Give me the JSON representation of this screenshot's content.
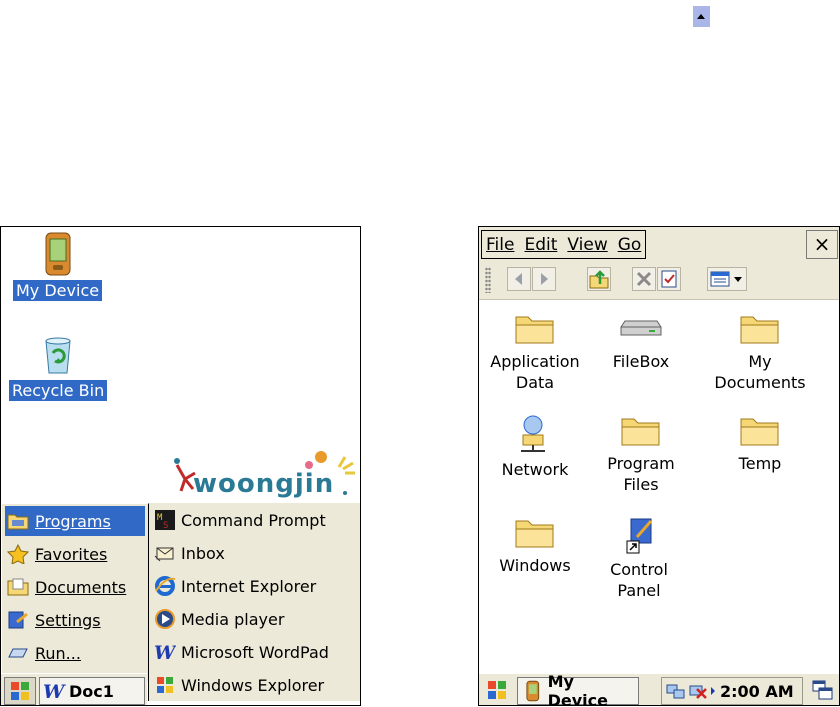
{
  "left_screen": {
    "desktop_icons": [
      {
        "label": "My Device",
        "icon": "pda-device-icon"
      },
      {
        "label": "Recycle Bin",
        "icon": "recycle-bin-icon"
      }
    ],
    "logo_text": "woongjin",
    "start_menu": {
      "items": [
        {
          "label": "Programs",
          "icon": "programs-folder-icon",
          "selected": true
        },
        {
          "label": "Favorites",
          "icon": "star-icon"
        },
        {
          "label": "Documents",
          "icon": "documents-folder-icon"
        },
        {
          "label": "Settings",
          "icon": "settings-icon"
        },
        {
          "label": "Run...",
          "icon": "run-icon"
        }
      ]
    },
    "programs_submenu": {
      "items": [
        {
          "label": "Command Prompt",
          "icon": "command-prompt-icon"
        },
        {
          "label": "Inbox",
          "icon": "inbox-icon"
        },
        {
          "label": "Internet Explorer",
          "icon": "internet-explorer-icon"
        },
        {
          "label": "Media player",
          "icon": "media-player-icon"
        },
        {
          "label": "Microsoft WordPad",
          "icon": "wordpad-icon"
        },
        {
          "label": "Windows Explorer",
          "icon": "windows-explorer-icon"
        }
      ]
    },
    "taskbar": {
      "task_label": "Doc1"
    }
  },
  "right_screen": {
    "menus": [
      "File",
      "Edit",
      "View",
      "Go"
    ],
    "close_label": "×",
    "items": [
      {
        "label": "Application Data",
        "icon": "folder-icon"
      },
      {
        "label": "FileBox",
        "icon": "disk-drive-icon"
      },
      {
        "label": "My Documents",
        "icon": "folder-icon"
      },
      {
        "label": "Network",
        "icon": "network-icon"
      },
      {
        "label": "Program Files",
        "icon": "folder-icon"
      },
      {
        "label": "Temp",
        "icon": "folder-icon"
      },
      {
        "label": "Windows",
        "icon": "folder-icon"
      },
      {
        "label": "Control Panel",
        "icon": "control-panel-shortcut-icon"
      }
    ],
    "taskbar": {
      "task_label": "My Device",
      "clock": "2:00 AM"
    }
  },
  "colors": {
    "selection": "#3169c6",
    "chrome": "#ece9d8",
    "folder": "#f5d776"
  }
}
